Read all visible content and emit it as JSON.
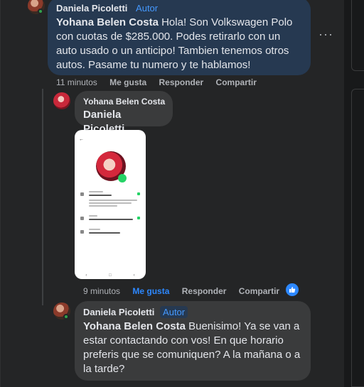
{
  "comments": [
    {
      "author": "Daniela Picoletti",
      "badge": "Autor",
      "mention": "Yohana Belen Costa",
      "text": "Hola! Son Volkswagen Polo con cuotas de $285.000. Podes retirarlo con un auto usado o un anticipo! Tambien tenemos otros autos. Pasame tu numero y te hablamos!",
      "time": "11 minutos",
      "like": "Me gusta",
      "reply": "Responder",
      "share": "Compartir"
    },
    {
      "author": "Yohana Belen Costa",
      "mention": "Daniela Picoletti",
      "time": "9 minutos",
      "like": "Me gusta",
      "reply": "Responder",
      "share": "Compartir"
    },
    {
      "author": "Daniela Picoletti",
      "badge": "Autor",
      "mention": "Yohana Belen Costa",
      "text": "Buenisimo! Ya se van a estar contactando con vos! En que horario preferis que se comuniquen? A la mañana o a la tarde?"
    }
  ],
  "icons": {
    "more": "more-options-icon",
    "like_reaction": "thumbs-up-icon"
  },
  "colors": {
    "background": "#242526",
    "bubble": "#3a3b3c",
    "highlight_bubble": "#263951",
    "accent": "#2d88ff",
    "online": "#31a24c"
  }
}
